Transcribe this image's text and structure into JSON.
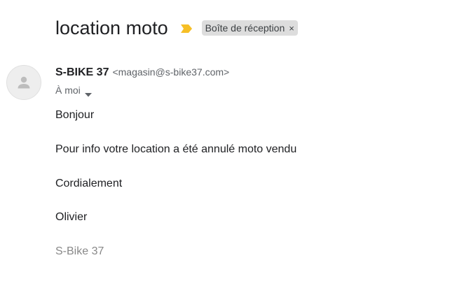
{
  "email": {
    "subject": "location moto",
    "label": "Boîte de réception",
    "label_close": "×",
    "sender": {
      "name": "S-BIKE 37",
      "email": "<magasin@s-bike37.com>"
    },
    "recipient_text": "À moi",
    "body": [
      "Bonjour",
      "Pour info votre location a été annulé moto vendu",
      "Cordialement",
      "Olivier"
    ],
    "signature": "S-Bike 37"
  },
  "icons": {
    "importance": "importance-marker-icon",
    "avatar": "person-icon",
    "recipients": "caret-down-icon"
  },
  "colors": {
    "importance": "#f6bf26",
    "chip_bg": "#dddddd",
    "avatar_bg": "#eeeeee",
    "signature": "#888888"
  }
}
